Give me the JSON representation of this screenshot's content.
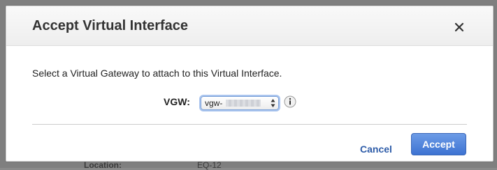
{
  "background_page": {
    "label": "Location:",
    "value": "EQ-12"
  },
  "dialog": {
    "title": "Accept Virtual Interface",
    "instruction": "Select a Virtual Gateway to attach to this Virtual Interface.",
    "vgw_label": "VGW:",
    "vgw_select_value": "vgw-",
    "cancel_label": "Cancel",
    "accept_label": "Accept"
  },
  "colors": {
    "accent": "#3e73d2",
    "link": "#2e5ca8"
  },
  "icons": {
    "close": "close-icon",
    "info": "info-icon",
    "select_arrows": "chevron-updown-icon"
  }
}
